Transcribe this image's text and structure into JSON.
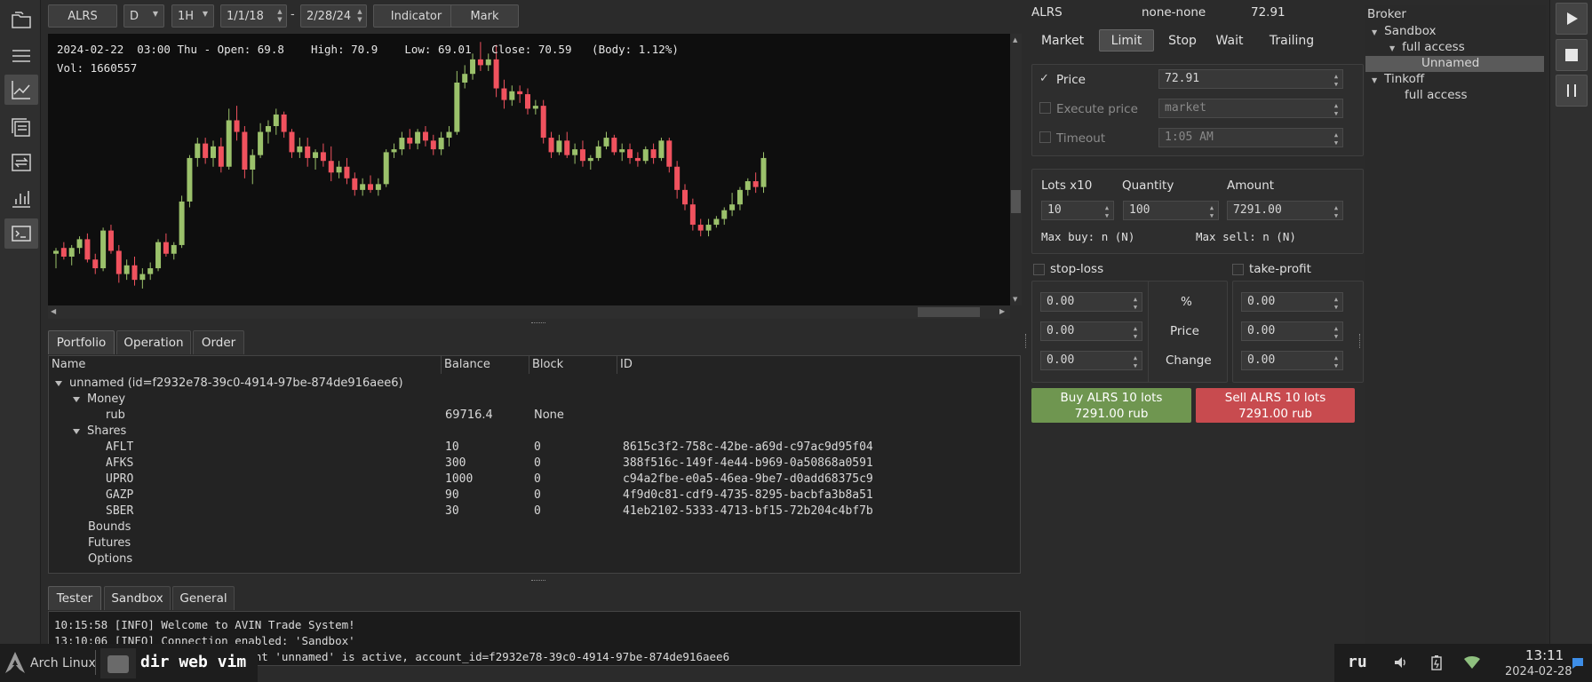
{
  "toolbar": {
    "ticker": "ALRS",
    "timeframe": "D",
    "interval": "1H",
    "date_from": "1/1/18",
    "date_sep": "-",
    "date_to": "2/28/24",
    "indicator_label": "Indicator",
    "mark_label": "Mark"
  },
  "chart": {
    "info": "2024-02-22  03:00 Thu - Open: 69.8    High: 70.9    Low: 69.01   Close: 70.59   (Body: 1.12%)",
    "volume": "Vol: 1660557",
    "colors": {
      "up": "#9bc16b",
      "down": "#f0525e",
      "background": "#0e0e0e"
    },
    "candles": [
      [
        63.6,
        63.8,
        63.1,
        63.7
      ],
      [
        63.8,
        64.0,
        63.4,
        63.5
      ],
      [
        63.5,
        63.9,
        63.2,
        63.8
      ],
      [
        63.8,
        64.2,
        63.6,
        64.1
      ],
      [
        64.1,
        64.3,
        63.3,
        63.4
      ],
      [
        63.4,
        63.6,
        62.9,
        63.1
      ],
      [
        63.1,
        64.5,
        63.0,
        64.4
      ],
      [
        64.4,
        64.6,
        63.6,
        63.7
      ],
      [
        63.7,
        63.9,
        62.6,
        62.9
      ],
      [
        62.9,
        63.4,
        62.7,
        63.2
      ],
      [
        63.2,
        63.5,
        62.5,
        62.7
      ],
      [
        62.7,
        63.1,
        62.4,
        62.9
      ],
      [
        62.9,
        63.3,
        62.7,
        63.1
      ],
      [
        63.1,
        64.1,
        63.0,
        64.0
      ],
      [
        64.0,
        64.3,
        63.5,
        63.6
      ],
      [
        63.6,
        64.0,
        63.4,
        63.9
      ],
      [
        63.9,
        65.6,
        63.8,
        65.4
      ],
      [
        65.4,
        67.0,
        65.2,
        66.9
      ],
      [
        66.9,
        67.6,
        66.6,
        67.4
      ],
      [
        67.4,
        67.6,
        66.7,
        66.9
      ],
      [
        66.9,
        67.5,
        66.6,
        67.3
      ],
      [
        67.3,
        67.6,
        66.4,
        66.6
      ],
      [
        66.6,
        68.6,
        66.5,
        68.2
      ],
      [
        68.2,
        68.7,
        67.5,
        67.8
      ],
      [
        67.8,
        68.0,
        66.2,
        66.5
      ],
      [
        66.5,
        67.2,
        66.0,
        67.0
      ],
      [
        67.0,
        68.1,
        66.9,
        67.8
      ],
      [
        67.8,
        68.2,
        67.4,
        68.0
      ],
      [
        68.0,
        68.6,
        67.7,
        68.4
      ],
      [
        68.4,
        68.5,
        67.6,
        67.8
      ],
      [
        67.8,
        67.9,
        66.9,
        67.1
      ],
      [
        67.1,
        67.6,
        66.9,
        67.3
      ],
      [
        67.3,
        67.6,
        66.6,
        66.9
      ],
      [
        66.9,
        67.2,
        66.5,
        67.1
      ],
      [
        67.1,
        67.4,
        66.6,
        66.8
      ],
      [
        66.8,
        67.3,
        66.1,
        66.4
      ],
      [
        66.4,
        66.8,
        66.2,
        66.6
      ],
      [
        66.6,
        66.9,
        66.0,
        66.2
      ],
      [
        66.2,
        66.4,
        65.6,
        65.8
      ],
      [
        65.8,
        66.2,
        65.6,
        66.0
      ],
      [
        66.0,
        66.3,
        65.7,
        65.8
      ],
      [
        65.8,
        66.2,
        65.6,
        66.0
      ],
      [
        66.0,
        67.2,
        65.9,
        67.1
      ],
      [
        67.1,
        67.4,
        66.9,
        67.2
      ],
      [
        67.2,
        67.8,
        67.0,
        67.6
      ],
      [
        67.6,
        67.9,
        67.2,
        67.4
      ],
      [
        67.4,
        67.9,
        67.2,
        67.8
      ],
      [
        67.8,
        68.0,
        67.3,
        67.5
      ],
      [
        67.5,
        67.7,
        67.0,
        67.2
      ],
      [
        67.2,
        67.8,
        67.0,
        67.6
      ],
      [
        67.6,
        68.0,
        67.3,
        67.8
      ],
      [
        67.8,
        69.9,
        67.7,
        69.5
      ],
      [
        69.5,
        70.1,
        69.3,
        69.8
      ],
      [
        69.8,
        70.5,
        69.6,
        70.3
      ],
      [
        70.3,
        70.9,
        69.9,
        70.1
      ],
      [
        70.1,
        70.5,
        69.9,
        70.3
      ],
      [
        70.3,
        70.8,
        69.0,
        69.3
      ],
      [
        69.3,
        69.6,
        68.6,
        68.9
      ],
      [
        68.9,
        69.4,
        68.7,
        69.2
      ],
      [
        69.2,
        69.4,
        68.8,
        69.1
      ],
      [
        69.1,
        69.3,
        68.4,
        68.6
      ],
      [
        68.6,
        68.9,
        68.4,
        68.7
      ],
      [
        68.7,
        68.9,
        67.4,
        67.6
      ],
      [
        67.6,
        67.8,
        66.9,
        67.1
      ],
      [
        67.1,
        67.7,
        67.0,
        67.5
      ],
      [
        67.5,
        67.8,
        66.9,
        67.0
      ],
      [
        67.0,
        67.4,
        66.7,
        67.2
      ],
      [
        67.2,
        67.5,
        66.6,
        66.8
      ],
      [
        66.8,
        67.0,
        66.5,
        66.9
      ],
      [
        66.9,
        67.5,
        66.8,
        67.3
      ],
      [
        67.3,
        67.8,
        67.2,
        67.6
      ],
      [
        67.6,
        67.7,
        67.0,
        67.1
      ],
      [
        67.1,
        67.4,
        66.8,
        67.2
      ],
      [
        67.2,
        67.4,
        66.7,
        66.9
      ],
      [
        66.9,
        67.1,
        66.6,
        66.8
      ],
      [
        66.8,
        67.3,
        66.7,
        67.2
      ],
      [
        67.2,
        67.4,
        66.7,
        66.9
      ],
      [
        66.9,
        67.6,
        66.8,
        67.5
      ],
      [
        67.5,
        67.6,
        66.4,
        66.6
      ],
      [
        66.6,
        66.8,
        65.5,
        65.8
      ],
      [
        65.8,
        66.0,
        65.1,
        65.3
      ],
      [
        65.3,
        65.5,
        64.4,
        64.6
      ],
      [
        64.6,
        64.8,
        64.2,
        64.4
      ],
      [
        64.4,
        64.8,
        64.2,
        64.6
      ],
      [
        64.6,
        64.9,
        64.5,
        64.8
      ],
      [
        64.8,
        65.2,
        64.6,
        65.1
      ],
      [
        65.1,
        65.7,
        64.9,
        65.3
      ],
      [
        65.3,
        65.9,
        65.1,
        65.8
      ],
      [
        65.8,
        66.2,
        65.6,
        66.1
      ],
      [
        66.1,
        66.4,
        65.7,
        65.9
      ],
      [
        65.9,
        67.1,
        65.7,
        66.9
      ]
    ],
    "price_range": [
      62.0,
      71.0
    ]
  },
  "bottom_tabs": {
    "portfolio": "Portfolio",
    "operation": "Operation",
    "order": "Order"
  },
  "portfolio": {
    "headers": {
      "name": "Name",
      "balance": "Balance",
      "block": "Block",
      "id": "ID"
    },
    "account": "unnamed (id=f2932e78-39c0-4914-97be-874de916aee6)",
    "money_label": "Money",
    "money": [
      {
        "name": "rub",
        "balance": "69716.4",
        "block": "None",
        "id": ""
      }
    ],
    "shares_label": "Shares",
    "shares": [
      {
        "name": "AFLT",
        "balance": "10",
        "block": "0",
        "id": "8615c3f2-758c-42be-a69d-c97ac9d95f04"
      },
      {
        "name": "AFKS",
        "balance": "300",
        "block": "0",
        "id": "388f516c-149f-4e44-b969-0a50868a0591"
      },
      {
        "name": "UPRO",
        "balance": "1000",
        "block": "0",
        "id": "c94a2fbe-e0a5-46ea-9be7-d0add68375c9"
      },
      {
        "name": "GAZP",
        "balance": "90",
        "block": "0",
        "id": "4f9d0c81-cdf9-4735-8295-bacbfa3b8a51"
      },
      {
        "name": "SBER",
        "balance": "30",
        "block": "0",
        "id": "41eb2102-5333-4713-bf15-72b204c4bf7b"
      }
    ],
    "bounds": "Bounds",
    "futures": "Futures",
    "options": "Options"
  },
  "console_tabs": {
    "tester": "Tester",
    "sandbox": "Sandbox",
    "general": "General"
  },
  "console": {
    "lines": [
      "10:15:58 [INFO] Welcome to AVIN Trade System!",
      "13:10:06 [INFO] Connection enabled: 'Sandbox'",
      "13:10:06 [INFO] Sandbox' account 'unnamed' is active, account_id=f2932e78-39c0-4914-97be-874de916aee6"
    ]
  },
  "order": {
    "ticker": "ALRS",
    "account": "none-none",
    "last_price": "72.91",
    "tabs": {
      "market": "Market",
      "limit": "Limit",
      "stop": "Stop",
      "wait": "Wait",
      "trailing": "Trailing"
    },
    "price_label": "Price",
    "price_value": "72.91",
    "price_check": "✓",
    "exec_label": "Execute price",
    "exec_value": "market",
    "timeout_label": "Timeout",
    "timeout_value": "1:05 AM",
    "lots_label": "Lots x10",
    "quantity_label": "Quantity",
    "amount_label": "Amount",
    "lots_value": "10",
    "quantity_value": "100",
    "amount_value": "7291.00",
    "max_buy": "Max buy: n (N)",
    "max_sell": "Max sell: n (N)",
    "stop_loss_label": "stop-loss",
    "take_profit_label": "take-profit",
    "sl_values": [
      "0.00",
      "0.00",
      "0.00"
    ],
    "tp_values": [
      "0.00",
      "0.00",
      "0.00"
    ],
    "mid_labels": {
      "percent": "%",
      "price": "Price",
      "change": "Change"
    },
    "buy_line1": "Buy ALRS 10 lots",
    "buy_line2": "7291.00 rub",
    "sell_line1": "Sell ALRS 10 lots",
    "sell_line2": "7291.00 rub",
    "buy_color": "#6f9650",
    "sell_color": "#c84b4f"
  },
  "broker": {
    "title": "Broker",
    "sandbox": "Sandbox",
    "sandbox_access": "full access",
    "sandbox_account": "Unnamed",
    "tinkoff": "Tinkoff",
    "tinkoff_access": "full access"
  },
  "taskbar": {
    "os_name": "Arch Linux",
    "workspaces": "dir web vim",
    "lang": "ru",
    "time": "13:11",
    "date": "2024-02-28"
  }
}
